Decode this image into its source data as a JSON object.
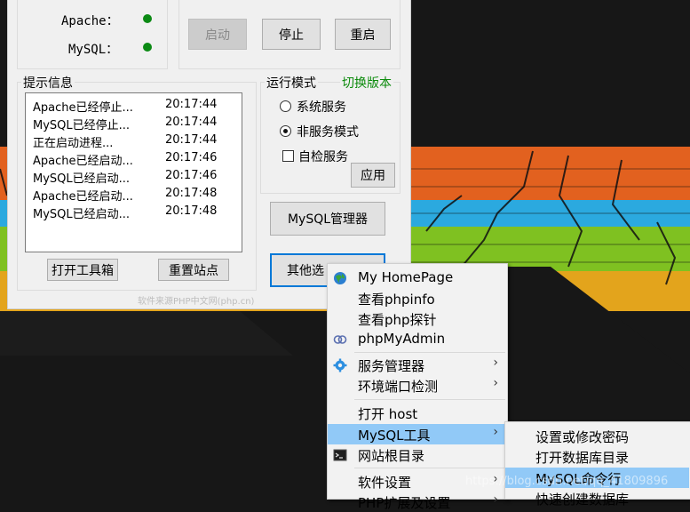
{
  "status": {
    "apache_label": "Apache：",
    "mysql_label": "MySQL：",
    "apache_color": "#0b8a14",
    "mysql_color": "#0b8a14"
  },
  "controls": {
    "start_label": "启动",
    "stop_label": "停止",
    "restart_label": "重启"
  },
  "log": {
    "title": "提示信息",
    "rows": [
      {
        "message": "Apache已经停止...",
        "time": "20:17:44"
      },
      {
        "message": "MySQL已经停止...",
        "time": "20:17:44"
      },
      {
        "message": "正在启动进程...",
        "time": "20:17:44"
      },
      {
        "message": "Apache已经启动...",
        "time": "20:17:46"
      },
      {
        "message": "MySQL已经启动...",
        "time": "20:17:46"
      },
      {
        "message": "Apache已经启动...",
        "time": "20:17:48"
      },
      {
        "message": "MySQL已经启动...",
        "time": "20:17:48"
      }
    ],
    "toolbox_label": "打开工具箱",
    "reset_label": "重置站点"
  },
  "mode": {
    "title": "运行模式",
    "switch_version_label": "切换版本",
    "system_service_label": "系统服务",
    "non_service_label": "非服务模式",
    "selected": "非服务模式",
    "self_check_label": "自检服务",
    "apply_label": "应用"
  },
  "mysql_manager_label": "MySQL管理器",
  "other_options_label": "其他选",
  "credit_text": "软件来源PHP中文网(php.cn)",
  "menu": {
    "items": [
      {
        "label": "My HomePage",
        "icon": "globe-icon"
      },
      {
        "label": "查看phpinfo",
        "icon": ""
      },
      {
        "label": "查看php探针",
        "icon": ""
      },
      {
        "label": "phpMyAdmin",
        "icon": "rings-icon"
      },
      {
        "label": "服务管理器",
        "icon": "gear-icon",
        "submenu": true
      },
      {
        "label": "环境端口检测",
        "icon": "",
        "submenu": true
      },
      {
        "label": "打开 host",
        "icon": ""
      },
      {
        "label": "MySQL工具",
        "icon": "",
        "submenu": true,
        "highlighted": true
      },
      {
        "label": "网站根目录",
        "icon": "terminal-icon"
      },
      {
        "label": "软件设置",
        "icon": "",
        "submenu": true
      },
      {
        "label": "PHP扩展及设置",
        "icon": "",
        "submenu": true
      }
    ],
    "highlight_color": "#91c9f7"
  },
  "submenu": {
    "items": [
      {
        "label": "设置或修改密码"
      },
      {
        "label": "打开数据库目录"
      },
      {
        "label": "MySQL命令行",
        "highlighted": true
      },
      {
        "label": "快速创建数据库"
      }
    ]
  },
  "watermark_text": "https://blog.csdn.net/qq_41809896",
  "wallpaper_colors": {
    "orange": "#e2611f",
    "blue": "#2ba9df",
    "green": "#7fc121",
    "yellow": "#e3a41c"
  }
}
